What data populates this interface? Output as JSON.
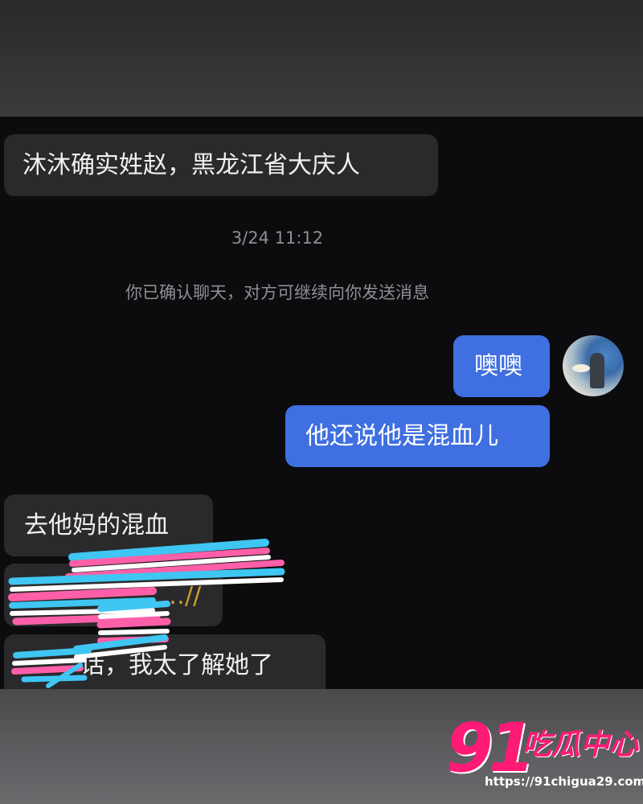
{
  "messages": [
    {
      "id": "m1",
      "direction": "incoming",
      "text": "沐沐确实姓赵，黑龙江省大庆人"
    },
    {
      "id": "m2",
      "direction": "outgoing",
      "text": "噢噢"
    },
    {
      "id": "m3",
      "direction": "outgoing",
      "text": "他还说他是混血儿"
    },
    {
      "id": "m4",
      "direction": "incoming",
      "text": "去他妈的混血"
    },
    {
      "id": "m5",
      "direction": "incoming",
      "text": "…//"
    },
    {
      "id": "m6",
      "direction": "incoming",
      "text": "话，我太了解她了"
    }
  ],
  "timestamp": "3/24 11:12",
  "system_notice": "你已确认聊天，对方可继续向你发送消息",
  "watermark": {
    "number": "91",
    "text": "吃瓜中心",
    "url": "https://91chigua29.com"
  },
  "colors": {
    "outgoing_bubble": "#3f6fe0",
    "incoming_bubble": "#2a2a2c",
    "chat_background": "#0c0c0e",
    "watermark_pink": "#ff1a75"
  }
}
